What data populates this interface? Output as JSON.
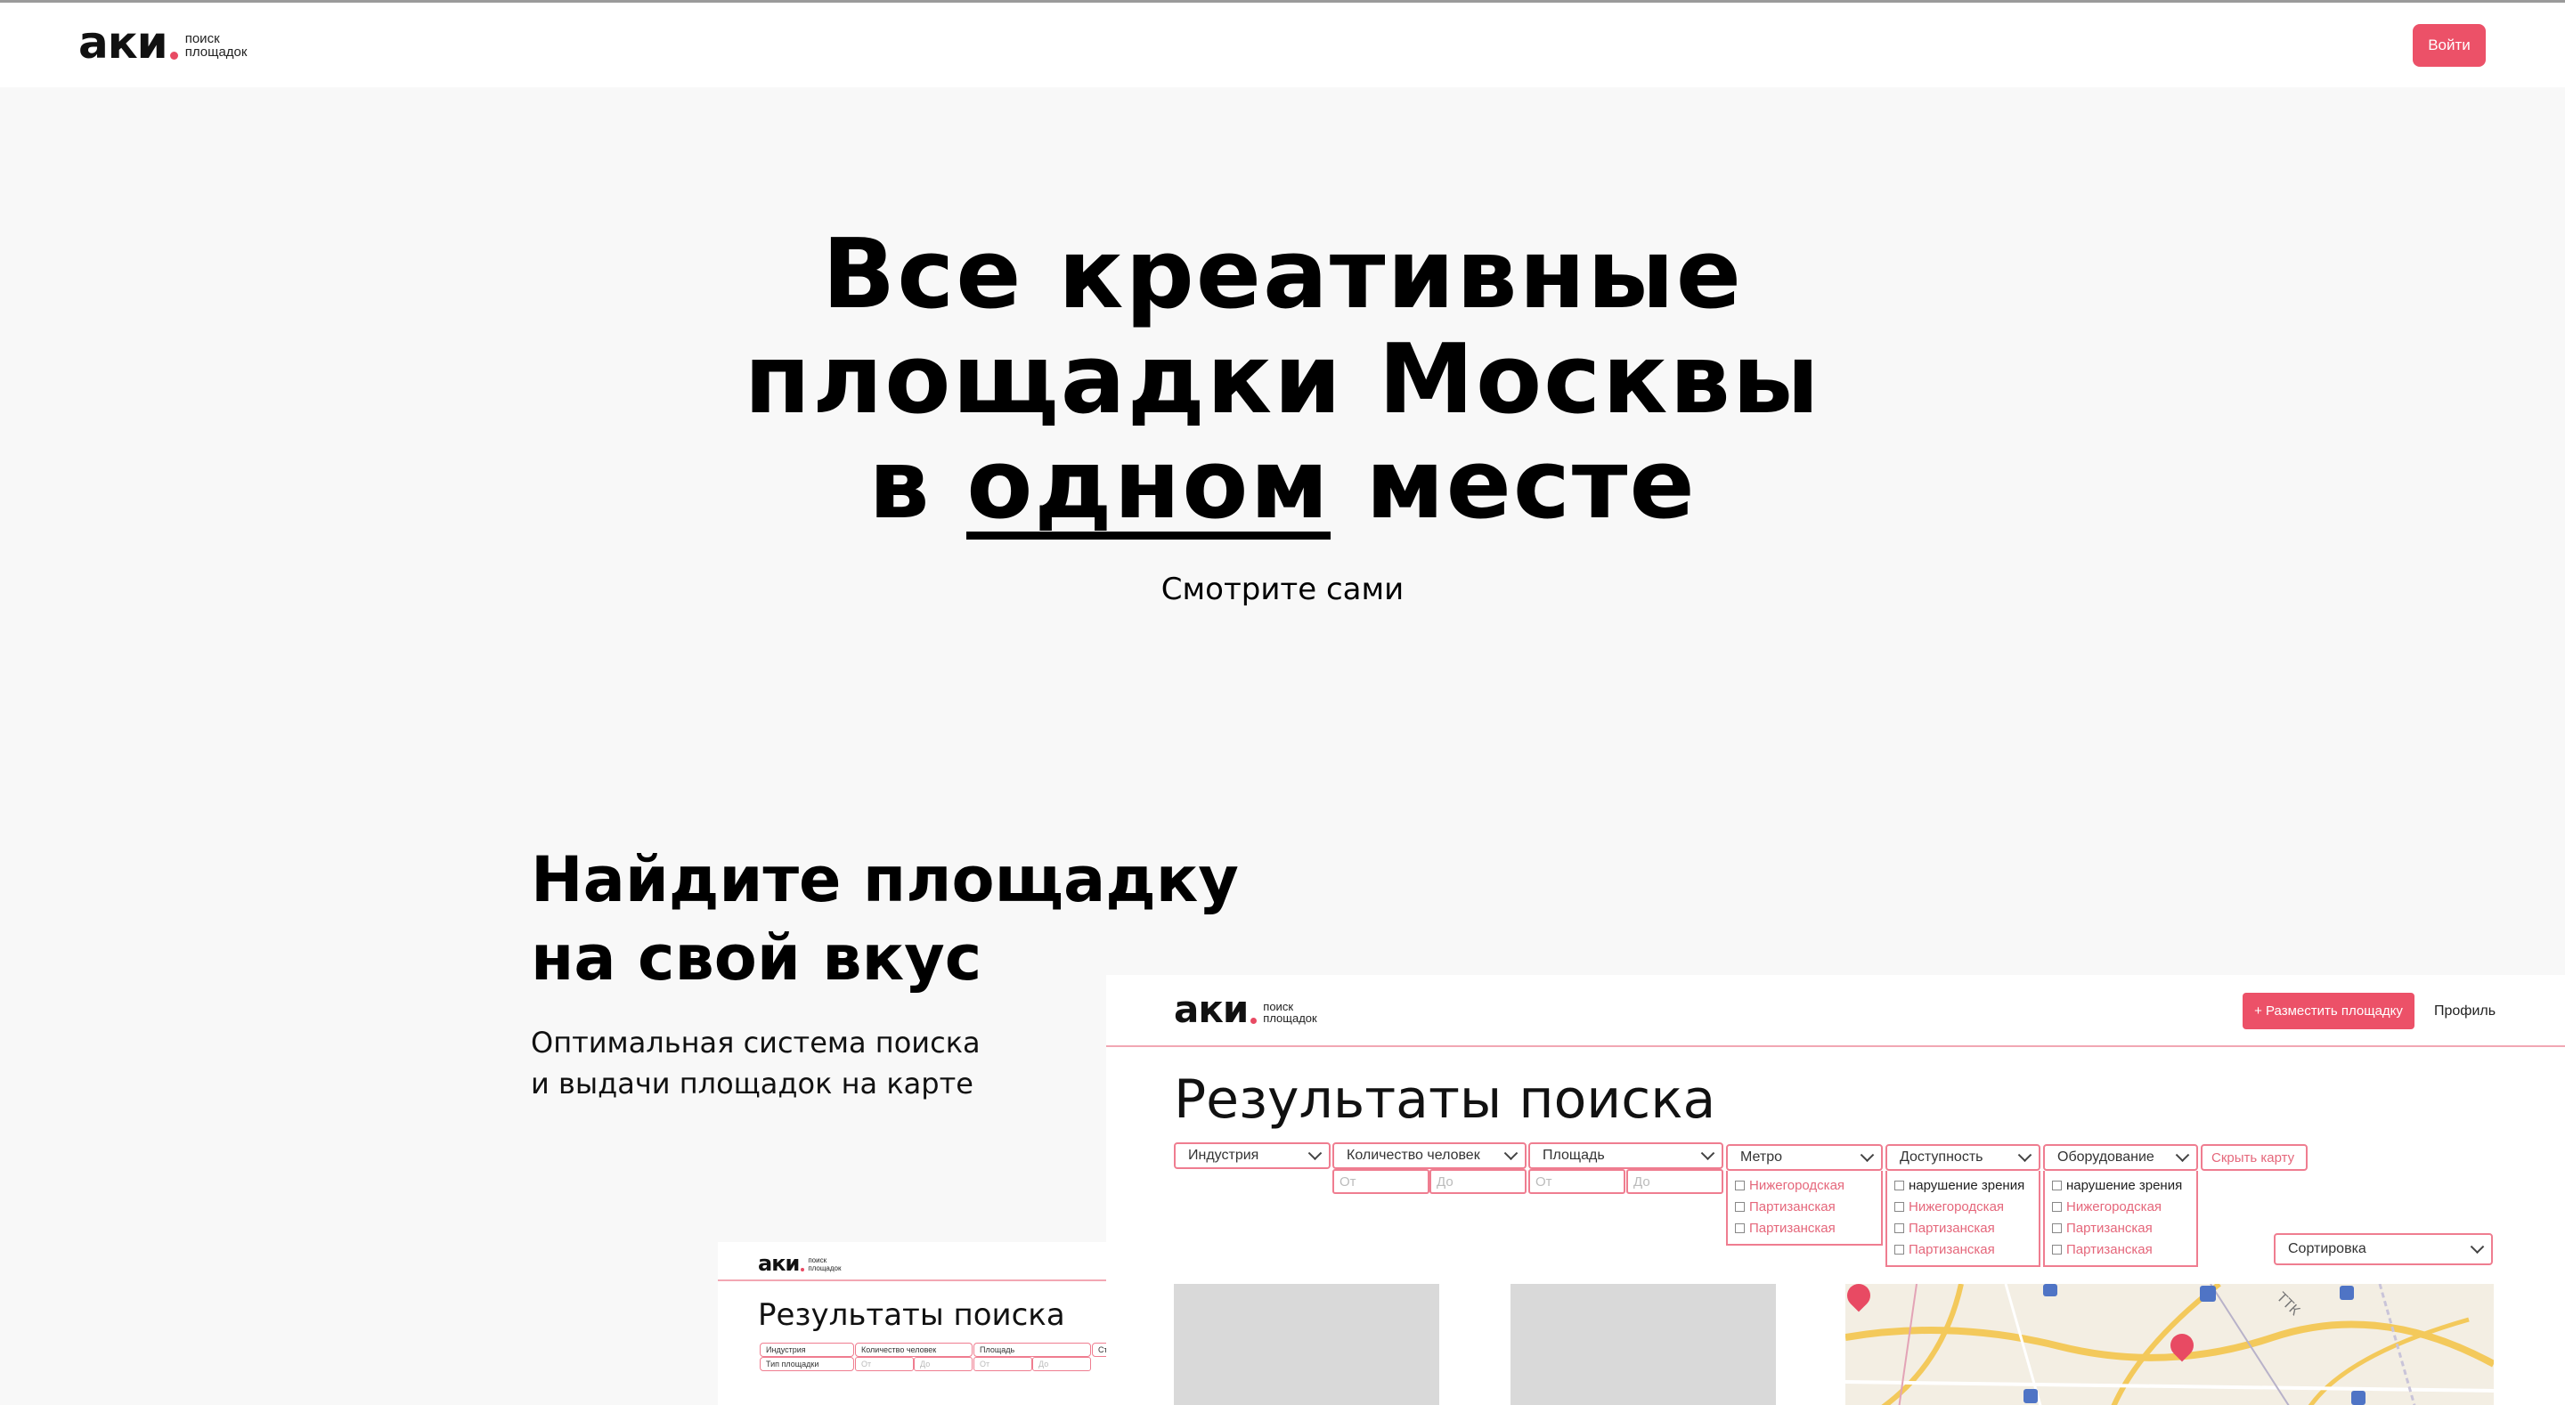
{
  "colors": {
    "accent": "#ec5168",
    "background": "#f8f8f8"
  },
  "header": {
    "logo_word": "аки",
    "logo_sub_line1": "поиск",
    "logo_sub_line2": "площадок",
    "login_label": "Войти"
  },
  "hero": {
    "title_line1": "Все креативные",
    "title_line2": "площадки Москвы",
    "title_line3_pre": "в",
    "title_line3_underlined": "одном",
    "title_line3_post": "месте",
    "subtitle": "Смотрите сами"
  },
  "feature": {
    "title_line1": "Найдите площадку",
    "title_line2": "на свой вкус",
    "desc_line1": "Оптимальная система поиска",
    "desc_line2": "и выдачи площадок на карте"
  },
  "mock_large": {
    "logo_word": "аки",
    "logo_sub_line1": "поиск",
    "logo_sub_line2": "площадок",
    "post_button": "+ Разместить площадку",
    "profile_link": "Профиль",
    "title": "Результаты поиска",
    "filters": {
      "industry": "Индустрия",
      "people": "Количество человек",
      "area": "Площадь",
      "metro": "Метро",
      "accessibility": "Доступность",
      "equipment": "Оборудование",
      "hide_map": "Скрыть карту"
    },
    "range": {
      "from": "От",
      "to": "До"
    },
    "metro_options": [
      "Нижегородская",
      "Партизанская",
      "Партизанская"
    ],
    "accessibility_options": [
      "нарушение зрения",
      "Нижегородская",
      "Партизанская",
      "Партизанская"
    ],
    "equipment_options": [
      "нарушение зрения",
      "Нижегородская",
      "Партизанская",
      "Партизанская"
    ],
    "sort_label": "Сортировка",
    "map_label": "ТТК"
  },
  "mock_small": {
    "logo_word": "аки",
    "logo_sub_line1": "поиск",
    "logo_sub_line2": "площадок",
    "title": "Результаты поиска",
    "filters": {
      "industry": "Индустрия",
      "people": "Количество человек",
      "area": "Площадь",
      "more": "Ста"
    },
    "type_label": "Тип площадки",
    "range": {
      "from": "От",
      "to": "До"
    }
  }
}
